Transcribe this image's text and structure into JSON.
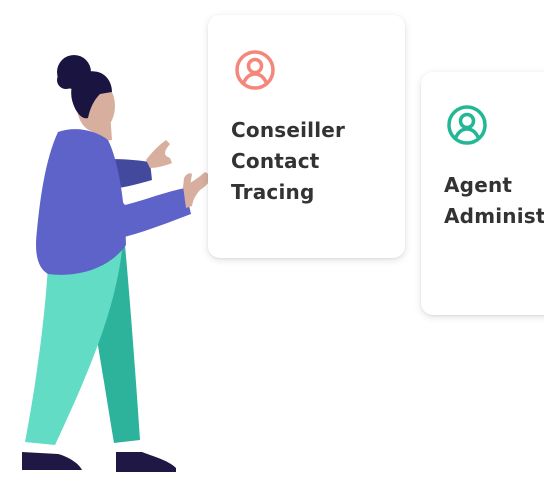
{
  "cards": [
    {
      "label": "Conseiller\nContact\nTracing",
      "icon": "user-circle-icon",
      "accent": "#f4867a"
    },
    {
      "label": "Agent\nAdministration",
      "icon": "user-circle-icon",
      "accent": "#22b795"
    }
  ],
  "colors": {
    "hair": "#1a1540",
    "skin": "#d8ae9f",
    "shirt": "#5d63c9",
    "shirt_dark": "#434a9e",
    "pants_light": "#62dcc4",
    "pants_dark": "#2db39c",
    "shoes": "#1f1845"
  }
}
